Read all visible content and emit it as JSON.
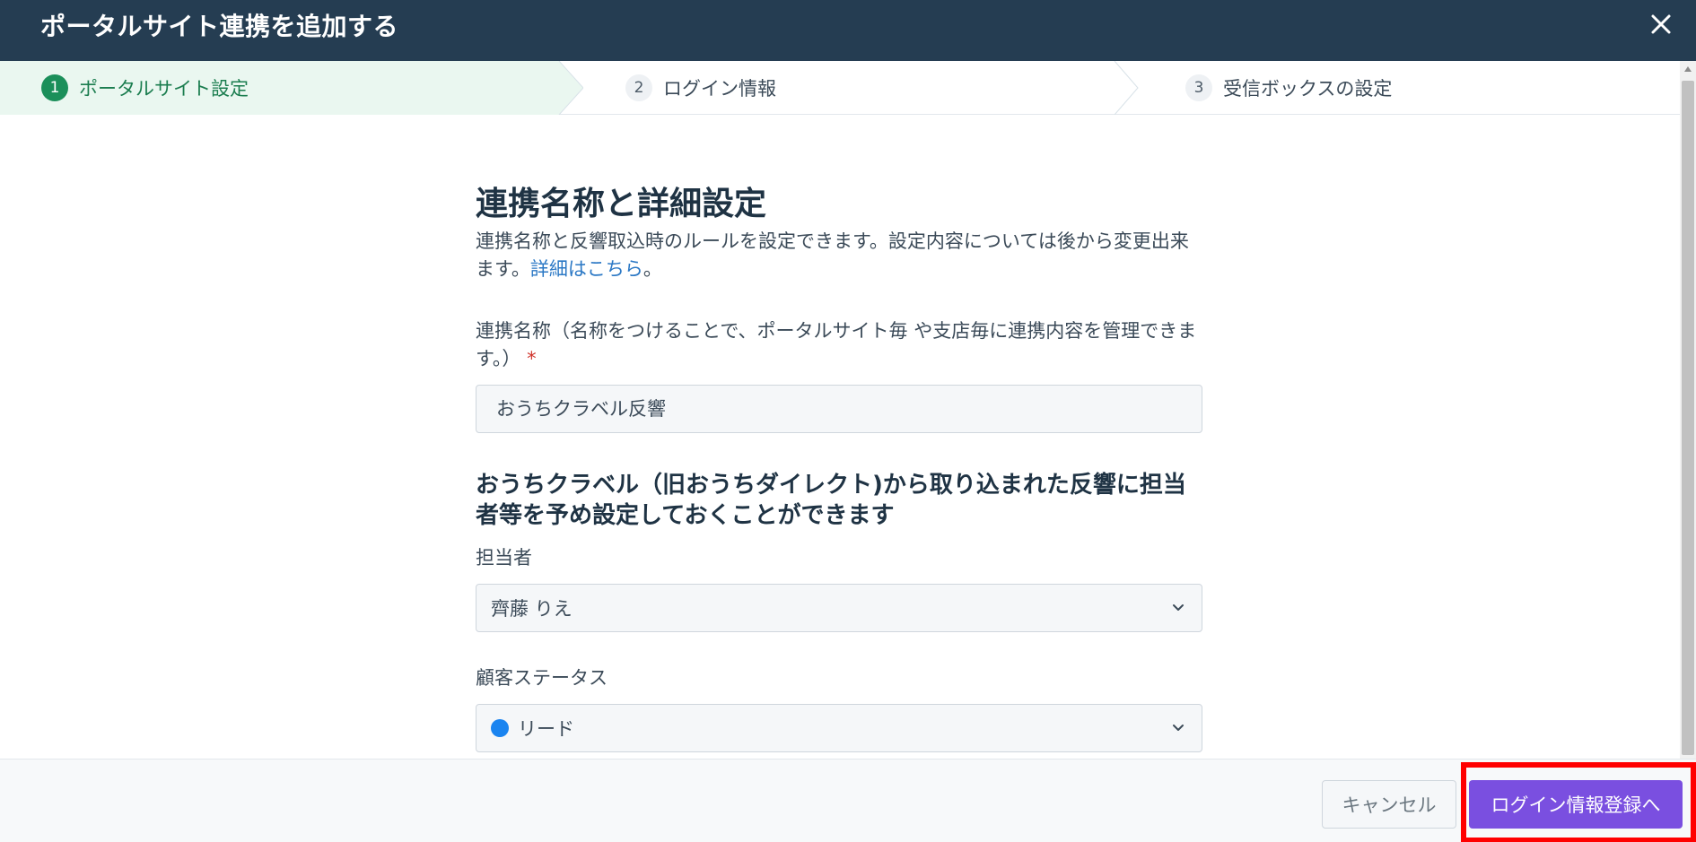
{
  "colors": {
    "header_bg": "#253d52",
    "step_active_bg": "#eaf7f0",
    "step_active_accent": "#1b8f5a",
    "link": "#2b78c5",
    "primary_btn": "#7a4fe0",
    "status_dot": "#1a84f0",
    "highlight": "#ff0000"
  },
  "header": {
    "title": "ポータルサイト連携を追加する",
    "close_icon": "close-icon"
  },
  "stepper": {
    "steps": [
      {
        "num": "1",
        "label": "ポータルサイト設定",
        "active": true
      },
      {
        "num": "2",
        "label": "ログイン情報",
        "active": false
      },
      {
        "num": "3",
        "label": "受信ボックスの設定",
        "active": false
      }
    ]
  },
  "main": {
    "title": "連携名称と詳細設定",
    "description": "連携名称と反響取込時のルールを設定できます。設定内容については後から変更出来ます。",
    "description_link": "詳細はこちら",
    "description_end": "。",
    "name_field": {
      "label": "連携名称（名称をつけることで、ポータルサイト毎 や支店毎に連携内容を管理できます。）",
      "required_mark": "*",
      "value": "おうちクラベル反響"
    },
    "subsection_title": "おうちクラベル（旧おうちダイレクト)から取り込まれた反響に担当者等を予め設定しておくことができます",
    "assignee": {
      "label": "担当者",
      "value": "齊藤 りえ"
    },
    "customer_status": {
      "label": "顧客ステータス",
      "value": "リード"
    }
  },
  "footer": {
    "cancel_label": "キャンセル",
    "next_label": "ログイン情報登録へ"
  }
}
